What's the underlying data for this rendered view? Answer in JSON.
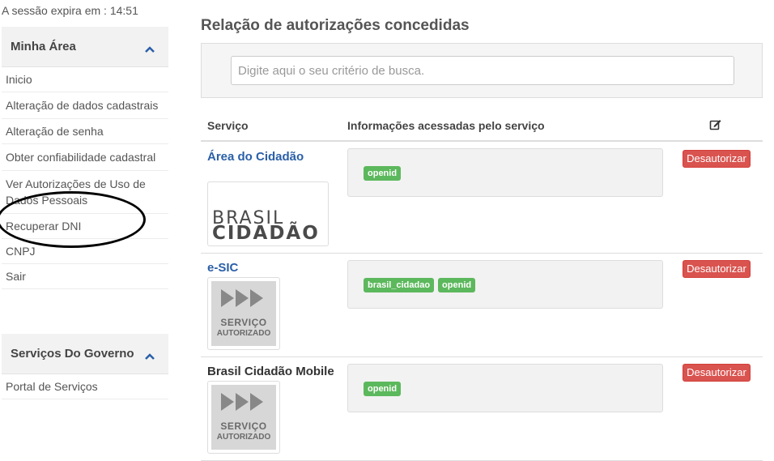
{
  "session": {
    "label": "A sessão expira em : 14:51"
  },
  "sidebar": {
    "minha_area": {
      "title": "Minha Área",
      "items": [
        {
          "label": "Inicio"
        },
        {
          "label": "Alteração de dados cadastrais"
        },
        {
          "label": "Alteração de senha"
        },
        {
          "label": "Obter confiabilidade cadastral"
        },
        {
          "label": "Ver Autorizações de Uso de Dados Pessoais"
        },
        {
          "label": "Recuperar DNI"
        },
        {
          "label": "CNPJ"
        },
        {
          "label": "Sair"
        }
      ]
    },
    "servicos": {
      "title": "Serviços Do Governo",
      "items": [
        {
          "label": "Portal de Serviços"
        }
      ]
    }
  },
  "main": {
    "title": "Relação de autorizações concedidas",
    "search": {
      "placeholder": "Digite aqui o seu critério de busca.",
      "value": ""
    },
    "table": {
      "headers": {
        "service": "Serviço",
        "info": "Informações acessadas pelo serviço",
        "edit_icon": "edit-icon"
      },
      "revoke_label": "Desautorizar",
      "rows": [
        {
          "name": "Área do Cidadão",
          "logo": {
            "line1": "BRASIL",
            "line2": "CIDADÃO"
          },
          "tags": [
            "openid"
          ]
        },
        {
          "name": "e-SIC",
          "logo": {
            "line1": "SERVIÇO",
            "line2": "AUTORIZADO"
          },
          "tags": [
            "brasil_cidadao",
            "openid"
          ]
        },
        {
          "name": "Brasil Cidadão Mobile",
          "logo": {
            "line1": "SERVIÇO",
            "line2": "AUTORIZADO"
          },
          "tags": [
            "openid"
          ]
        }
      ]
    }
  },
  "colors": {
    "link": "#2a5fa8",
    "danger": "#d9534f",
    "success": "#5cb85c",
    "annotation": "#000000"
  }
}
